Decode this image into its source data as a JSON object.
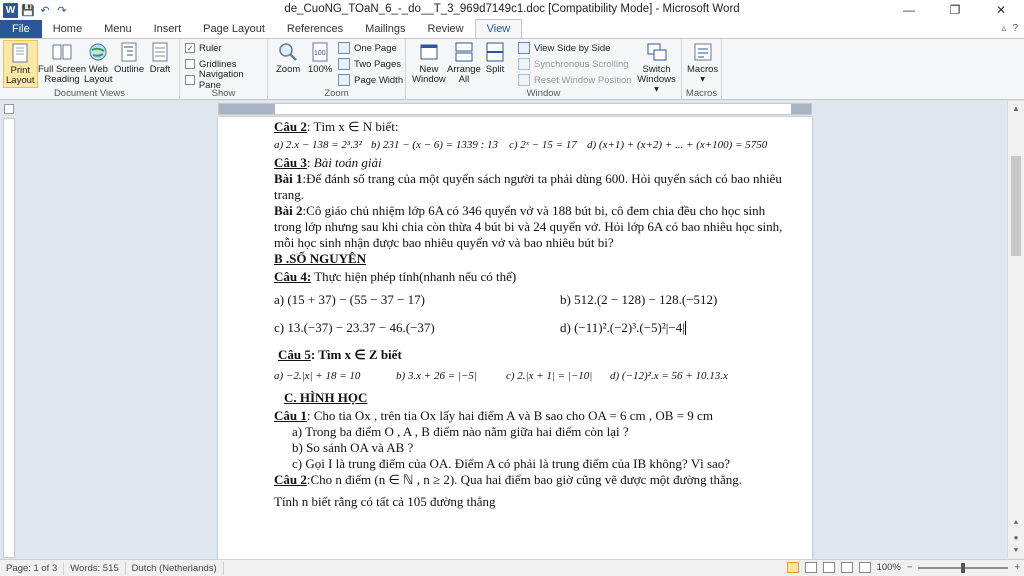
{
  "window": {
    "title": "de_CuoNG_TOaN_6_-_do__T_3_969d7149c1.doc [Compatibility Mode]  -  Microsoft Word",
    "app_icon": "W",
    "controls": {
      "minimize": "—",
      "restore": "❐",
      "close": "✕"
    }
  },
  "qat": {
    "save": "💾",
    "undo": "↶",
    "redo": "↷"
  },
  "tabs": [
    "File",
    "Home",
    "Menu",
    "Insert",
    "Page Layout",
    "References",
    "Mailings",
    "Review",
    "View"
  ],
  "active_tab": "View",
  "ribbon": {
    "document_views": {
      "label": "Document Views",
      "buttons": [
        {
          "l1": "Print",
          "l2": "Layout"
        },
        {
          "l1": "Full Screen",
          "l2": "Reading"
        },
        {
          "l1": "Web",
          "l2": "Layout"
        },
        {
          "l1": "Outline",
          "l2": ""
        },
        {
          "l1": "Draft",
          "l2": ""
        }
      ]
    },
    "show": {
      "label": "Show",
      "ruler": "Ruler",
      "gridlines": "Gridlines",
      "nav_pane": "Navigation Pane",
      "ruler_checked": "✓"
    },
    "zoom": {
      "label": "Zoom",
      "zoom": "Zoom",
      "hundred": "100%",
      "one_page": "One Page",
      "two_pages": "Two Pages",
      "page_width": "Page Width"
    },
    "window": {
      "label": "Window",
      "new_window": {
        "l1": "New",
        "l2": "Window"
      },
      "arrange_all": {
        "l1": "Arrange",
        "l2": "All"
      },
      "split": "Split",
      "side_by_side": "View Side by Side",
      "sync_scroll": "Synchronous Scrolling",
      "reset_pos": "Reset Window Position",
      "switch": {
        "l1": "Switch",
        "l2": "Windows ▾"
      }
    },
    "macros": {
      "label": "Macros",
      "button": "Macros",
      "arrow": "▾"
    }
  },
  "document": {
    "cau2_title": "Câu 2",
    "cau2_rest": ": Tìm x ∈ N  biết:",
    "cau2_math": [
      "a) 2.x − 138 = 2³.3²",
      "b) 231 − (x − 6) = 1339 : 13",
      "c) 2ˣ − 15 = 17",
      "d) (x+1) + (x+2) + ... + (x+100) = 5750"
    ],
    "cau3_title": "Câu 3",
    "cau3_rest": ": ",
    "cau3_italic": "Bài toán giải",
    "bai1_label": "Bài 1",
    "bai1_text": ":Để đánh số trang của một quyển sách người ta phải dùng 600. Hỏi quyển sách có bao nhiêu trang.",
    "bai2_label": "Bài 2",
    "bai2_text": ":Cô giáo chủ nhiệm lớp 6A có 346 quyển vở và 188 bút bi, cô đem chia đều cho học sinh trong  lớp nhưng sau khi chia còn thừa 4 bút bi và 24 quyển vở. Hỏi lớp 6A có bao nhiêu học sinh, mỗi học sinh nhận được bao nhiêu quyển vở và bao nhiêu bút bi?",
    "section_b": "B .SỐ NGUYÊN",
    "cau4_title": "Câu 4:",
    "cau4_rest": " Thực hiện phép tính(nhanh nếu có thể)",
    "cau4_a": "a)  (15 + 37) − (55 − 37 − 17)",
    "cau4_b": "b) 512.(2 − 128) − 128.(−512)",
    "cau4_c": "c)  13.(−37) − 23.37 − 46.(−37)",
    "cau4_d": "d) (−11)².(−2)³.(−5)²|−4|",
    "cau5_title": "Câu 5",
    "cau5_rest": ": Tìm x ∈ Z biết",
    "cau5_math": [
      "a) −2.|x| + 18 = 10",
      "b) 3.x + 26 = |−5|",
      "c) 2.|x + 1| = |−10|",
      "d)  (−12)².x = 56 + 10.13.x"
    ],
    "section_c": "C. HÌNH HỌC",
    "hh1_title": "Câu 1",
    "hh1_rest": ": Cho tia Ox , trên tia Ox lấy hai điểm A và B sao cho OA = 6 cm , OB = 9 cm",
    "hh1_items": [
      "a)  Trong ba điểm O , A , B  điểm nào nằm giữa hai điểm còn lại ?",
      "b)  So sánh OA và AB ?",
      "c)  Gọi I là trung điểm của OA. Điểm A có phải là trung điểm của IB không? Vì sao?"
    ],
    "hh2_title": "Câu 2",
    "hh2_rest": ":Cho n điểm  (n ∈ ℕ , n ≥ 2). Qua hai điểm bao giờ cũng vẽ được một đường thẳng.",
    "hh2_line2": "Tính n biết rằng có tất cả 105 đường thẳng"
  },
  "status": {
    "page": "Page: 1 of 3",
    "words": "Words: 515",
    "language": "Dutch (Netherlands)",
    "zoom": "100%",
    "minus": "−",
    "plus": "+"
  },
  "colors": {
    "accent": "#2b579a",
    "ribbon_bg": "#f5f6f7",
    "selected": "#fce8a4"
  }
}
